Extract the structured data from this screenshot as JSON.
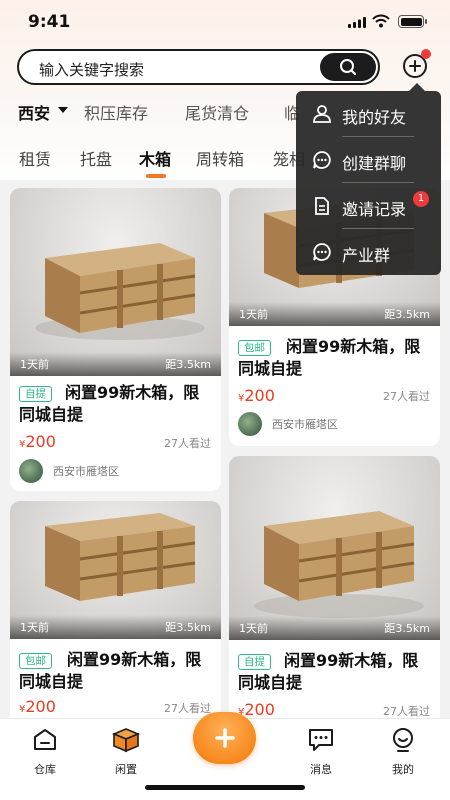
{
  "status": {
    "time": "9:41"
  },
  "search": {
    "placeholder": "输入关键字搜索"
  },
  "categories": {
    "city": "西安",
    "items": [
      "积压库存",
      "尾货清仓",
      "临"
    ]
  },
  "subtabs": [
    "租赁",
    "托盘",
    "木箱",
    "周转箱",
    "笼相"
  ],
  "active_subtab": "木箱",
  "listings": [
    {
      "ago": "1天前",
      "distance": "距3.5km",
      "tag": "自提",
      "title": "闲置99新木箱，限同城自提",
      "currency": "¥",
      "price": "200",
      "views": "27人看过",
      "location": "西安市雁塔区"
    },
    {
      "ago": "1天前",
      "distance": "距3.5km",
      "tag": "包邮",
      "title": "闲置99新木箱，限同城自提",
      "currency": "¥",
      "price": "200",
      "views": "27人看过",
      "location": "西安市雁塔区"
    },
    {
      "ago": "1天前",
      "distance": "距3.5km",
      "tag": "包邮",
      "title": "闲置99新木箱，限同城自提",
      "currency": "¥",
      "price": "200",
      "views": "27人看过",
      "location": ""
    },
    {
      "ago": "1天前",
      "distance": "距3.5km",
      "tag": "自提",
      "title": "闲置99新木箱，限同城自提",
      "currency": "¥",
      "price": "200",
      "views": "27人看过",
      "location": ""
    }
  ],
  "menu": {
    "items": [
      {
        "label": "我的好友",
        "icon": "user-icon"
      },
      {
        "label": "创建群聊",
        "icon": "chat-icon"
      },
      {
        "label": "邀请记录",
        "icon": "document-icon",
        "badge": "1"
      },
      {
        "label": "产业群",
        "icon": "chat-icon"
      }
    ]
  },
  "tabbar": {
    "items": [
      {
        "label": "仓库",
        "icon": "warehouse-icon"
      },
      {
        "label": "闲置",
        "icon": "box-icon"
      },
      {
        "label": "消息",
        "icon": "message-icon"
      },
      {
        "label": "我的",
        "icon": "profile-icon"
      }
    ]
  },
  "colors": {
    "accent": "#f07a22",
    "price": "#ee3b1f",
    "tag": "#2fb88a",
    "badge": "#ee3b3b"
  }
}
